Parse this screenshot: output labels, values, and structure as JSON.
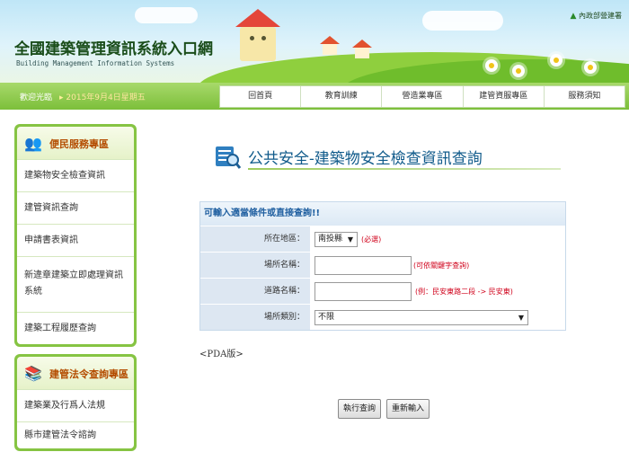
{
  "header": {
    "site_title": "全國建築管理資訊系統入口網",
    "site_subtitle": "Building Management Information Systems",
    "ministry": "內政部營建署"
  },
  "navbar": {
    "welcome": "歡迎光臨",
    "date": "2015年9月4日星期五",
    "tabs": [
      {
        "label": "回首頁"
      },
      {
        "label": "教育訓練"
      },
      {
        "label": "營造業專區"
      },
      {
        "label": "建管資服專區"
      },
      {
        "label": "服務須知"
      }
    ]
  },
  "sidebar": {
    "sections": [
      {
        "title": "便民服務專區",
        "icon": "people-icon",
        "items": [
          {
            "label": "建築物安全檢查資訊"
          },
          {
            "label": "建管資訊查詢"
          },
          {
            "label": "申請書表資訊"
          },
          {
            "label": "新違章建築立即處理資訊系統"
          },
          {
            "label": "建築工程履歷查詢"
          }
        ]
      },
      {
        "title": "建管法令查詢專區",
        "icon": "book-icon",
        "items": [
          {
            "label": "建築業及行爲人法規"
          },
          {
            "label": "縣市建管法令諮詢"
          }
        ]
      }
    ]
  },
  "main": {
    "page_title": "公共安全-建築物安全檢查資訊查詢",
    "form": {
      "heading": "可輸入適當條件或直接查詢!!",
      "region_label": "所在地區：",
      "region_value": "南投縣",
      "region_required": "(必選)",
      "venue_name_label": "場所名稱：",
      "venue_name_value": "",
      "venue_name_hint": "(可依關鍵字查詢)",
      "road_name_label": "道路名稱：",
      "road_name_value": "",
      "road_name_hint": "(例：民安東路二段 -> 民安東)",
      "venue_type_label": "場所類別：",
      "venue_type_value": "不限"
    },
    "pda_link": "<PDA版>",
    "buttons": {
      "search": "執行查詢",
      "reset": "重新輸入"
    }
  },
  "colors": {
    "nav_green": "#7cbf3a",
    "sidebar_green": "#86c443",
    "title_blue": "#0f5a8a",
    "hint_red": "#d0021b",
    "form_label_bg": "#dde7f2"
  }
}
